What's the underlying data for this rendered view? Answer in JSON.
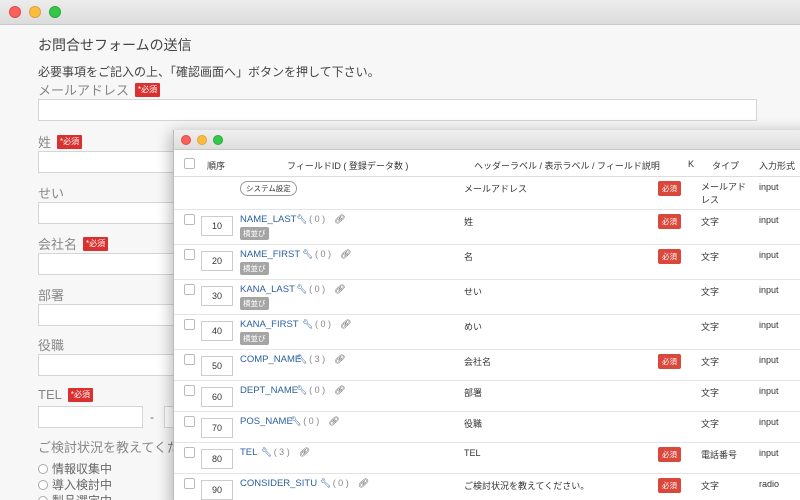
{
  "back_window": {
    "form_title": "お問合せフォームの送信",
    "form_description": "必要事項をご記入の上、「確認画面へ」ボタンを押して下さい。",
    "required_label": "*必須",
    "fields": {
      "email": "メールアドレス",
      "last_name": "姓",
      "first_name": "せい",
      "company": "会社名",
      "department": "部署",
      "position": "役職",
      "tel": "TEL",
      "tel_separator": "-",
      "consider": "ご検討状況を教えてくださ"
    },
    "consider_options": [
      "情報収集中",
      "導入検討中",
      "製品選定中"
    ]
  },
  "front_window": {
    "headers": {
      "order": "順序",
      "field_id": "フィールドID ( 登録データ数 )",
      "labels": "ヘッダーラベル / 表示ラベル / フィールド説明",
      "k": "K",
      "type": "タイプ",
      "input_format": "入力形式"
    },
    "system_row": {
      "badge": "システム設定",
      "label": "メールアドレス",
      "required": "必須",
      "type": "メールアド レス",
      "input": "input"
    },
    "rows": [
      {
        "order": "10",
        "id": "NAME_LAST",
        "count": "( 0 )",
        "tag": "横並び",
        "label": "姓",
        "required": "必須",
        "type": "文字",
        "input": "input"
      },
      {
        "order": "20",
        "id": "NAME_FIRST",
        "count": "( 0 )",
        "tag": "横並び",
        "label": "名",
        "required": "必須",
        "type": "文字",
        "input": "input"
      },
      {
        "order": "30",
        "id": "KANA_LAST",
        "count": "( 0 )",
        "tag": "横並び",
        "label": "せい",
        "required": "",
        "type": "文字",
        "input": "input"
      },
      {
        "order": "40",
        "id": "KANA_FIRST",
        "count": "( 0 )",
        "tag": "横並び",
        "label": "めい",
        "required": "",
        "type": "文字",
        "input": "input"
      },
      {
        "order": "50",
        "id": "COMP_NAME",
        "count": "( 3 )",
        "tag": "",
        "label": "会社名",
        "required": "必須",
        "type": "文字",
        "input": "input"
      },
      {
        "order": "60",
        "id": "DEPT_NAME",
        "count": "( 0 )",
        "tag": "",
        "label": "部署",
        "required": "",
        "type": "文字",
        "input": "input"
      },
      {
        "order": "70",
        "id": "POS_NAME",
        "count": "( 0 )",
        "tag": "",
        "label": "役職",
        "required": "",
        "type": "文字",
        "input": "input"
      },
      {
        "order": "80",
        "id": "TEL",
        "count": "( 3 )",
        "tag": "",
        "label": "TEL",
        "required": "必須",
        "type": "電話番号",
        "input": "input"
      },
      {
        "order": "90",
        "id": "CONSIDER_SITU",
        "count": "( 0 )",
        "tag": "",
        "label": "ご検討状況を教えてください。",
        "required": "必須",
        "type": "文字",
        "input": "radio"
      }
    ]
  }
}
